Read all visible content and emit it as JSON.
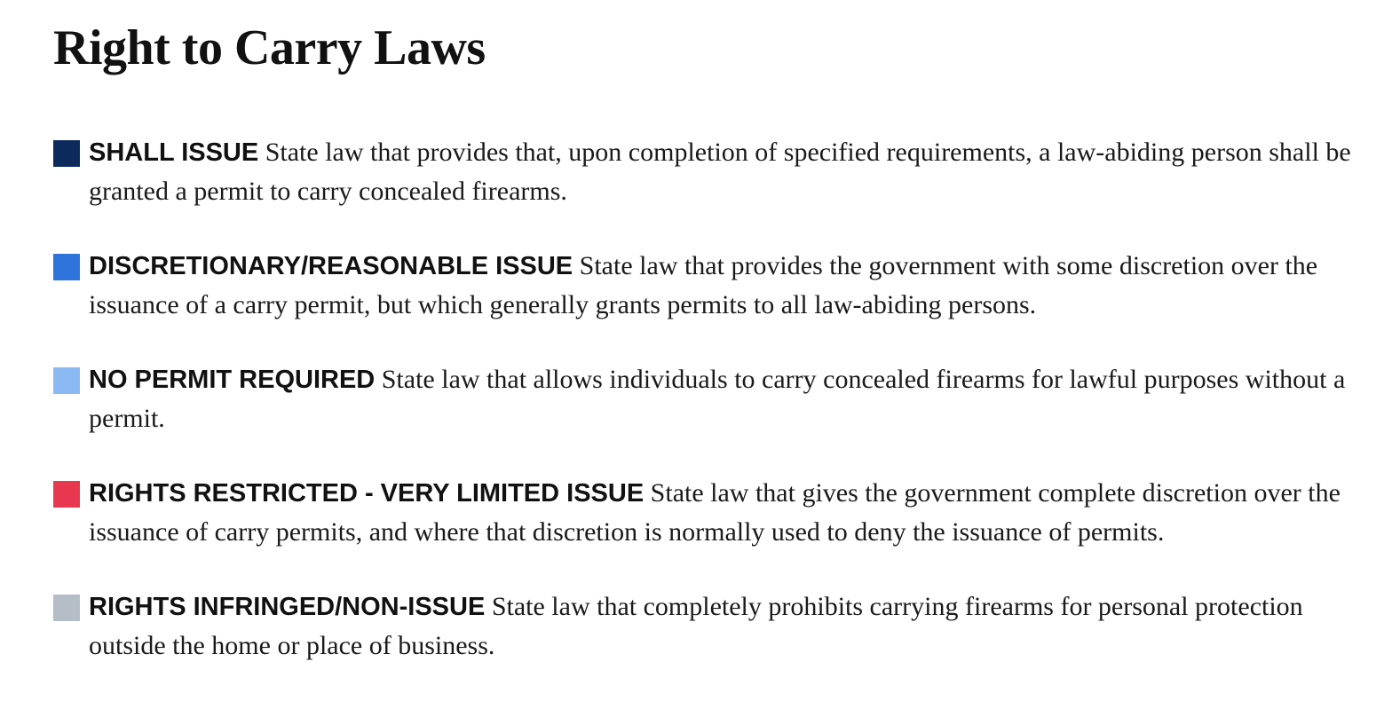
{
  "title": "Right to Carry Laws",
  "legend": [
    {
      "label": "SHALL ISSUE",
      "description": "State law that provides that, upon completion of specified requirements, a law-abiding person shall be granted a permit to carry concealed firearms.",
      "color": "#0d2a5c"
    },
    {
      "label": "DISCRETIONARY/REASONABLE ISSUE",
      "description": "State law that provides the government with some discretion over the issuance of a carry permit, but which generally grants permits to all law-abiding persons.",
      "color": "#2f74dc"
    },
    {
      "label": "NO PERMIT REQUIRED",
      "description": "State law that allows individuals to carry concealed firearms for lawful purposes without a permit.",
      "color": "#8ab9f4"
    },
    {
      "label": "RIGHTS RESTRICTED - VERY LIMITED ISSUE",
      "description": "State law that gives the government complete discretion over the issuance of carry permits, and where that discretion is normally used to deny the issuance of permits.",
      "color": "#e8384f"
    },
    {
      "label": "RIGHTS INFRINGED/NON-ISSUE",
      "description": "State law that completely prohibits carrying firearms for personal protection outside the home or place of business.",
      "color": "#b5bec6"
    }
  ]
}
